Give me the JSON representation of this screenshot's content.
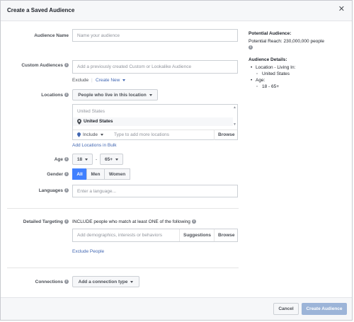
{
  "dialog": {
    "title": "Create a Saved Audience",
    "close_glyph": "✕"
  },
  "audience_name": {
    "label": "Audience Name",
    "placeholder": "Name your audience"
  },
  "custom_audiences": {
    "label": "Custom Audiences",
    "placeholder": "Add a previously created Custom or Lookalike Audience",
    "exclude_label": "Exclude",
    "separator": "|",
    "create_new_label": "Create New"
  },
  "locations": {
    "label": "Locations",
    "dropdown_label": "People who live in this location",
    "group_header": "United States",
    "selected_location": "United States",
    "include_label": "Include",
    "search_placeholder": "Type to add more locations",
    "browse_label": "Browse",
    "bulk_link": "Add Locations in Bulk"
  },
  "age": {
    "label": "Age",
    "min_value": "18",
    "dash": "-",
    "max_value": "65+"
  },
  "gender": {
    "label": "Gender",
    "options": [
      "All",
      "Men",
      "Women"
    ],
    "selected": "All"
  },
  "languages": {
    "label": "Languages",
    "placeholder": "Enter a language..."
  },
  "detailed_targeting": {
    "label": "Detailed Targeting",
    "description": "INCLUDE people who match at least ONE of the following",
    "placeholder": "Add demographics, interests or behaviors",
    "suggestions_label": "Suggestions",
    "browse_label": "Browse",
    "exclude_link": "Exclude People"
  },
  "connections": {
    "label": "Connections",
    "dropdown_label": "Add a connection type"
  },
  "summary": {
    "potential_heading": "Potential Audience:",
    "potential_reach": "Potential Reach: 230,000,000 people",
    "details_heading": "Audience Details:",
    "location_item": "Location - Living In:",
    "location_value": "United States",
    "age_item": "Age:",
    "age_value": "18 - 65+"
  },
  "footer": {
    "cancel_label": "Cancel",
    "create_label": "Create Audience"
  },
  "colors": {
    "accent": "#4080ff",
    "link": "#4267b2",
    "disabled_button": "#9cb4d8"
  }
}
